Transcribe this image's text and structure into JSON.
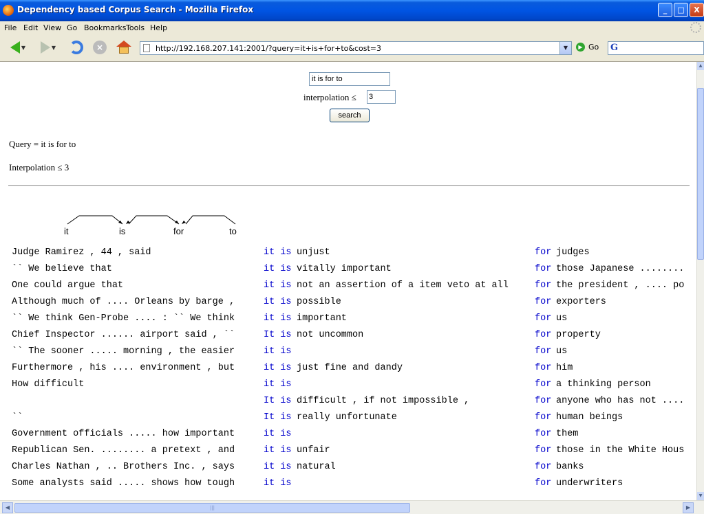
{
  "window": {
    "title": "Dependency based Corpus Search - Mozilla Firefox",
    "controls": {
      "minimize": "_",
      "maximize": "□",
      "close": "X"
    }
  },
  "menubar": {
    "items": [
      "File",
      "Edit",
      "View",
      "Go",
      "Bookmarks",
      "Tools",
      "Help"
    ]
  },
  "navbar": {
    "url": "http://192.168.207.141:2001/?query=it+is+for+to&cost=3",
    "go_label": "Go",
    "search_logo": "G"
  },
  "form": {
    "query_value": "it is for to",
    "interpolation_label": "interpolation ≤",
    "cost_value": "3",
    "search_button": "search"
  },
  "summary": {
    "query_text": "Query = it is for to",
    "interpolation_text": "Interpolation ≤ 3"
  },
  "dependency": {
    "words": [
      "it",
      "is",
      "for",
      "to"
    ]
  },
  "results": [
    {
      "left": "Judge Ramirez , 44 , said",
      "itis": "it is",
      "mid": "unjust",
      "for": "for",
      "right": "judges"
    },
    {
      "left": "`` We believe that",
      "itis": "it is",
      "mid": "vitally important",
      "for": "for",
      "right": "those Japanese ........"
    },
    {
      "left": "One could argue that",
      "itis": "it is",
      "mid": "not an assertion of a item veto at all",
      "for": "for",
      "right": "the president , .... po"
    },
    {
      "left": "Although much of .... Orleans by barge ,",
      "itis": "it is",
      "mid": "possible",
      "for": "for",
      "right": "exporters"
    },
    {
      "left": "`` We think Gen-Probe .... : `` We think",
      "itis": "it is",
      "mid": "important",
      "for": "for",
      "right": "us"
    },
    {
      "left": "Chief Inspector ...... airport said , ``",
      "itis": "It is",
      "mid": "not uncommon",
      "for": "for",
      "right": "property"
    },
    {
      "left": "`` The sooner ..... morning , the easier",
      "itis": "it is",
      "mid": "",
      "for": "for",
      "right": "us"
    },
    {
      "left": "Furthermore , his .... environment , but",
      "itis": "it is",
      "mid": "just fine and dandy",
      "for": "for",
      "right": "him"
    },
    {
      "left": "How difficult",
      "itis": "it is",
      "mid": "",
      "for": "for",
      "right": "a thinking person"
    },
    {
      "left": "",
      "itis": "It is",
      "mid": "difficult , if not impossible ,",
      "for": "for",
      "right": "anyone who has not ...."
    },
    {
      "left": "``",
      "itis": "It is",
      "mid": "really unfortunate",
      "for": "for",
      "right": "human beings"
    },
    {
      "left": "Government officials ..... how important",
      "itis": "it is",
      "mid": "",
      "for": "for",
      "right": "them"
    },
    {
      "left": "Republican Sen. ........ a pretext , and",
      "itis": "it is",
      "mid": "unfair",
      "for": "for",
      "right": "those in the White Hous"
    },
    {
      "left": "Charles Nathan , .. Brothers Inc. , says",
      "itis": "it is",
      "mid": "natural",
      "for": "for",
      "right": "banks"
    },
    {
      "left": "Some analysts said ..... shows how tough",
      "itis": "it is",
      "mid": "",
      "for": "for",
      "right": "underwriters"
    }
  ]
}
